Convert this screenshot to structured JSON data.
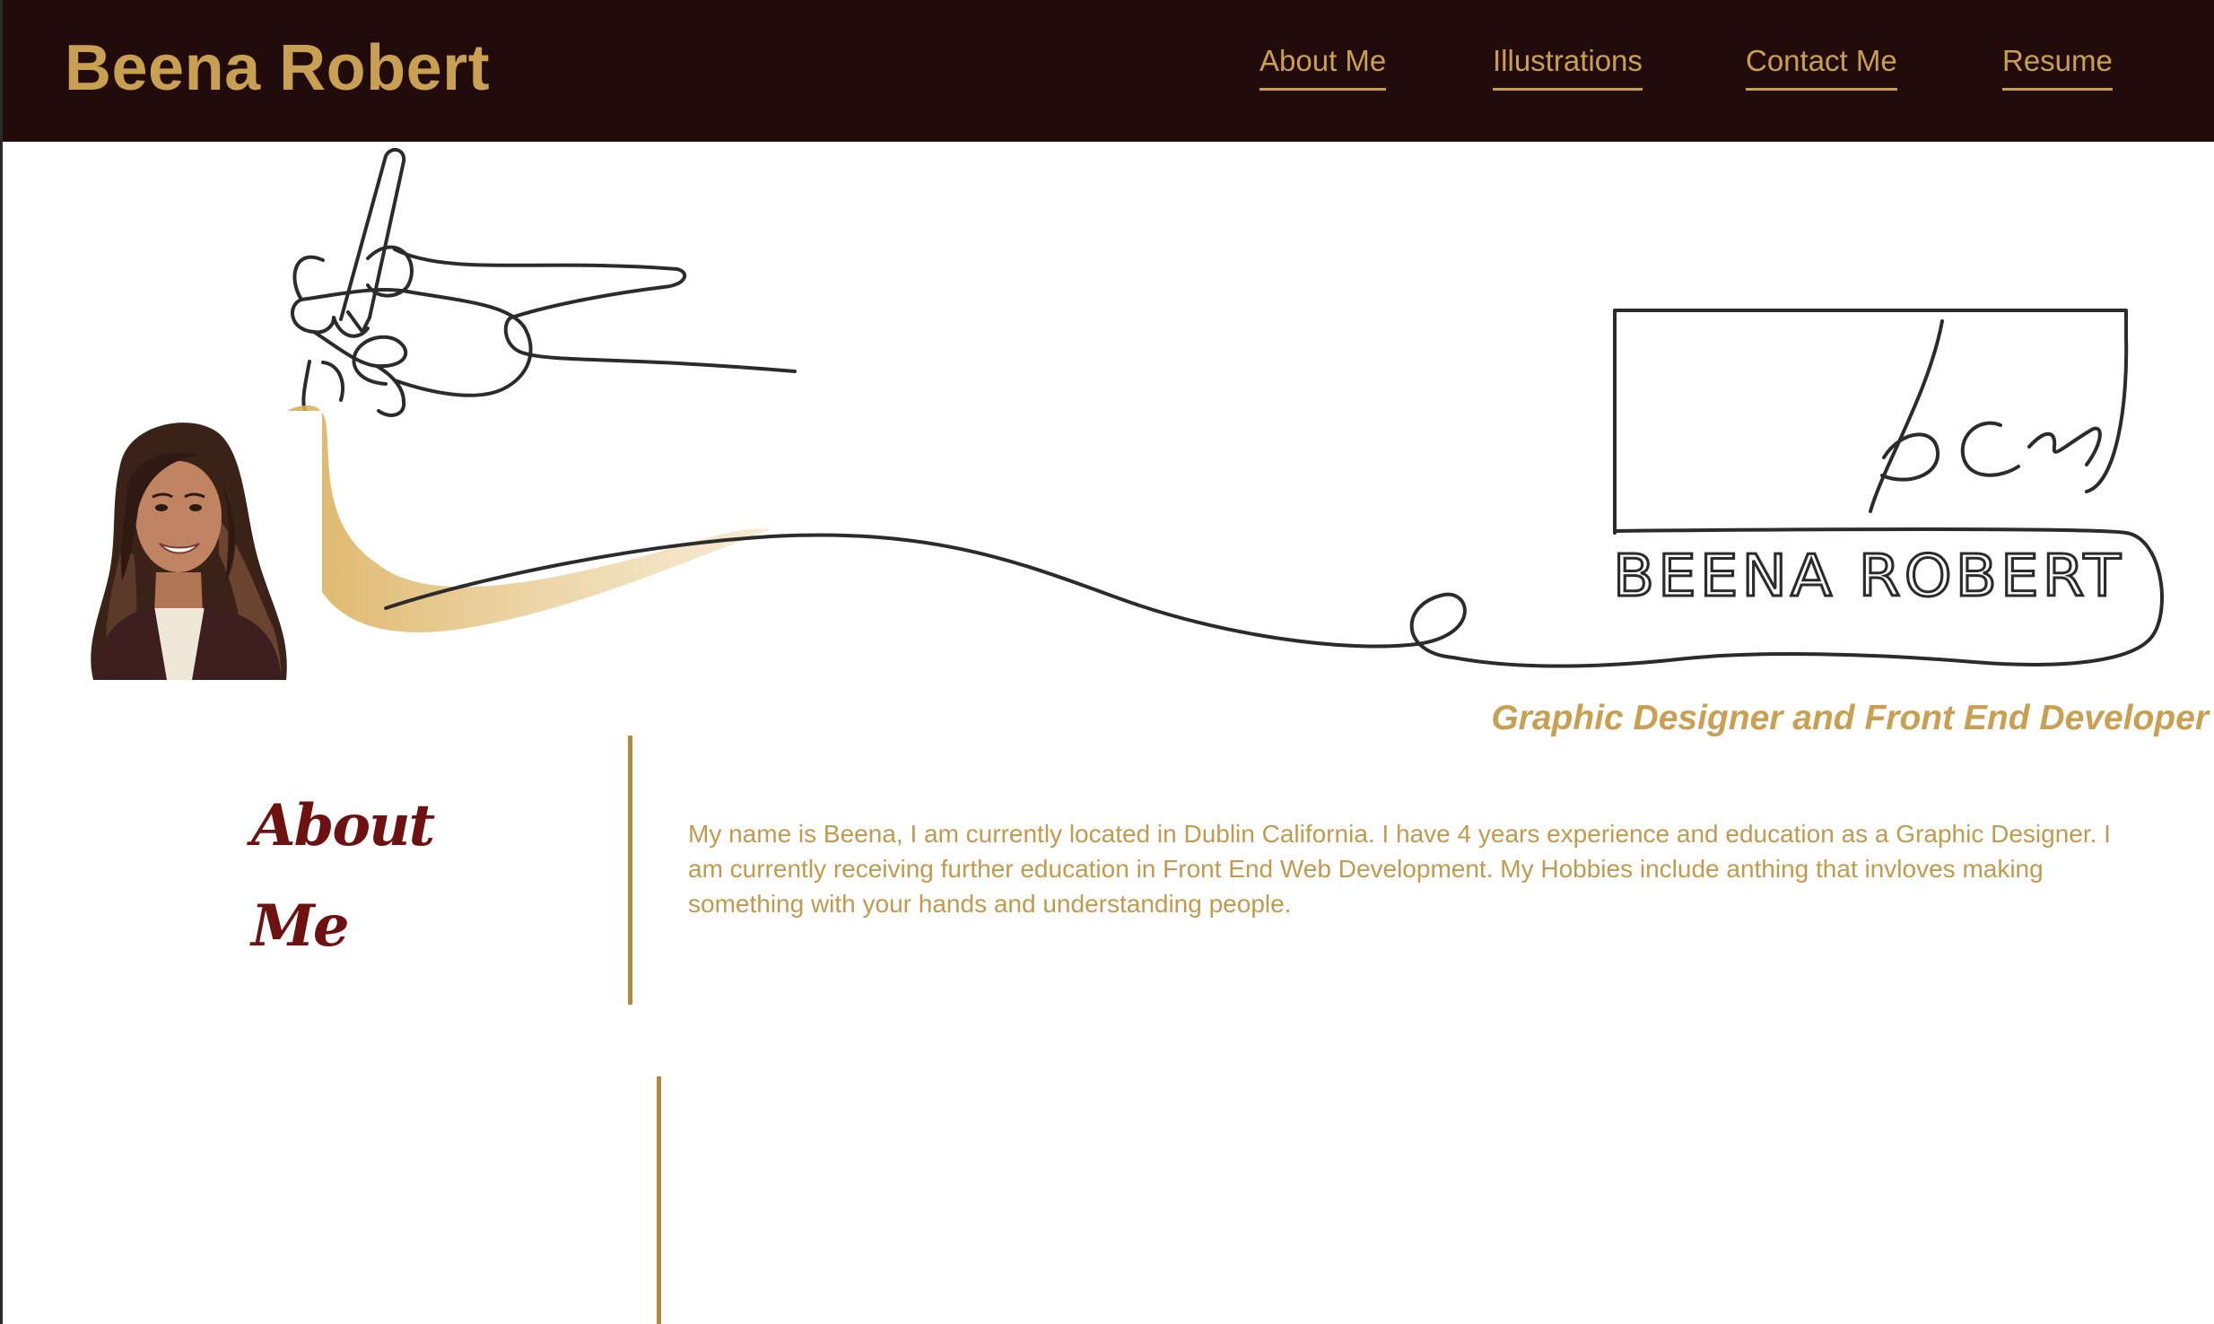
{
  "header": {
    "brand": "Beena Robert",
    "nav": [
      {
        "label": "About Me"
      },
      {
        "label": "Illustrations"
      },
      {
        "label": "Contact Me"
      },
      {
        "label": "Resume"
      }
    ]
  },
  "hero": {
    "logo_monogram": "bcr",
    "logo_name": "BEENA ROBERT",
    "tagline": "Graphic Designer and Front End Developer"
  },
  "about": {
    "title": "About Me",
    "text": "My name is Beena, I am currently located in Dublin California. I have 4 years experience and education as a Graphic Designer. I am currently receiving further education in Front End Web Development. My Hobbies include anthing that invloves making something with your hands and understanding people."
  },
  "colors": {
    "header_bg": "#220b0b",
    "accent_gold": "#c9a051",
    "heading_maroon": "#6e1111"
  }
}
